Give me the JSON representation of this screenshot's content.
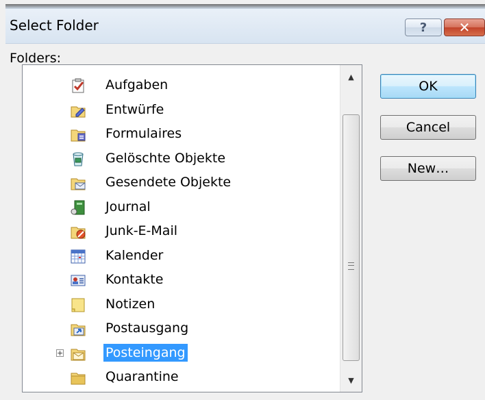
{
  "window": {
    "title": "Select Folder",
    "help_glyph": "?",
    "close_glyph": "✕"
  },
  "folders_label": "Folders:",
  "tree": {
    "items": [
      {
        "label": "Aufgaben",
        "icon": "tasks-icon"
      },
      {
        "label": "Entwürfe",
        "icon": "drafts-icon"
      },
      {
        "label": "Formulaires",
        "icon": "forms-folder-icon"
      },
      {
        "label": "Gelöschte Objekte",
        "icon": "deleted-items-icon"
      },
      {
        "label": "Gesendete Objekte",
        "icon": "sent-items-icon"
      },
      {
        "label": "Journal",
        "icon": "journal-icon"
      },
      {
        "label": "Junk-E-Mail",
        "icon": "junk-mail-icon"
      },
      {
        "label": "Kalender",
        "icon": "calendar-icon"
      },
      {
        "label": "Kontakte",
        "icon": "contacts-icon"
      },
      {
        "label": "Notizen",
        "icon": "notes-icon"
      },
      {
        "label": "Postausgang",
        "icon": "outbox-icon"
      },
      {
        "label": "Posteingang",
        "icon": "inbox-icon",
        "selected": true,
        "expandable": true
      },
      {
        "label": "Quarantine",
        "icon": "folder-icon"
      }
    ],
    "expander_glyph": "+"
  },
  "buttons": {
    "ok": "OK",
    "cancel": "Cancel",
    "new": "New…"
  },
  "scrollbar": {
    "up_glyph": "▲",
    "down_glyph": "▼"
  },
  "colors": {
    "selection": "#3399ff",
    "default_button_border": "#3c7fb1",
    "close_button": "#c2432a"
  }
}
